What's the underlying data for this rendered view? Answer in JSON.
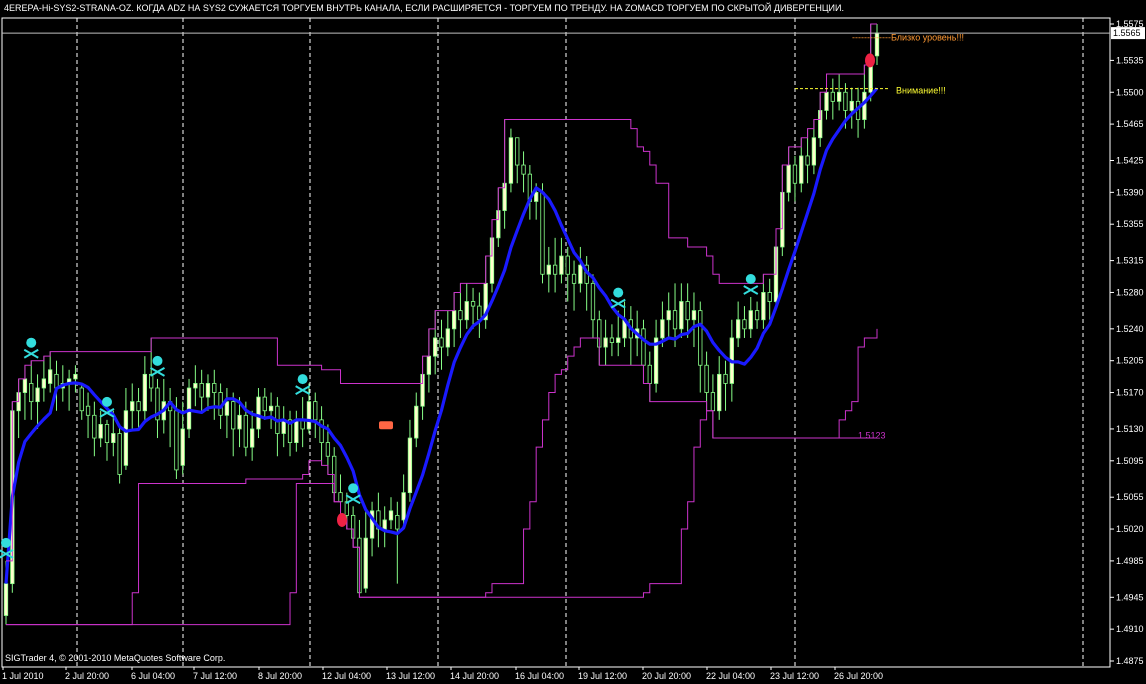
{
  "header": {
    "title": "4EREPA-Hi-SYS2-STRANA-OZ. КОГДА ADZ НА SYS2 СУЖАЕТСЯ ТОРГУЕМ ВНУТРЬ КАНАЛА, ЕСЛИ РАСШИРЯЕТСЯ - ТОРГУЕМ ПО ТРЕНДУ. НА ZOMACD ТОРГУЕМ ПО СКРЫТОЙ ДИВЕРГЕНЦИИ."
  },
  "footer": {
    "copyright": "SIGTrader 4, © 2001-2010 MetaQuotes Software Corp."
  },
  "colors": {
    "background": "#000000",
    "candle_up": "#ffffcc",
    "candle_down": "#000000",
    "wick": "#88ff88",
    "channel": "#cc33cc",
    "moving_average": "#1a1aff",
    "grid": "#ffffff",
    "price_line": "#c0c0c0",
    "skull": "#33dddd",
    "alert_near": "#ff9933",
    "alert_attention": "#ffff33",
    "channel_label": "#cc33cc"
  },
  "chart_data": {
    "type": "candlestick",
    "instrument_info": "4EREPA-Hi-SYS2-STRANA-OZ",
    "x_tick_labels": [
      "1 Jul 2010",
      "2 Jul 20:00",
      "6 Jul 04:00",
      "7 Jul 12:00",
      "8 Jul 20:00",
      "12 Jul 04:00",
      "13 Jul 12:00",
      "14 Jul 20:00",
      "16 Jul 04:00",
      "19 Jul 12:00",
      "20 Jul 20:00",
      "22 Jul 04:00",
      "23 Jul 12:00",
      "26 Jul 20:00"
    ],
    "y_tick_labels": [
      "1.5575",
      "1.5535",
      "1.5500",
      "1.5465",
      "1.5425",
      "1.5390",
      "1.5355",
      "1.5315",
      "1.5280",
      "1.5240",
      "1.5205",
      "1.5170",
      "1.5130",
      "1.5095",
      "1.5055",
      "1.5020",
      "1.4985",
      "1.4945",
      "1.4910",
      "1.4875"
    ],
    "ylim": [
      1.4875,
      1.5575
    ],
    "current_price": "1.5565",
    "channel_value_label": "1.5123",
    "annotations": {
      "near_level": "-------------Близко уровень!!!",
      "attention": "Внимание!!!"
    },
    "candles": [
      [
        1.4925,
        1.496,
        1.4915,
        1.4985
      ],
      [
        1.496,
        1.515,
        1.495,
        1.516
      ],
      [
        1.515,
        1.517,
        1.512,
        1.5185
      ],
      [
        1.517,
        1.5185,
        1.514,
        1.52
      ],
      [
        1.518,
        1.516,
        1.514,
        1.5205
      ],
      [
        1.516,
        1.5175,
        1.513,
        1.519
      ],
      [
        1.5175,
        1.5185,
        1.516,
        1.521
      ],
      [
        1.518,
        1.5195,
        1.517,
        1.5215
      ],
      [
        1.519,
        1.5175,
        1.515,
        1.5205
      ],
      [
        1.5175,
        1.518,
        1.516,
        1.52
      ],
      [
        1.518,
        1.5185,
        1.515,
        1.5195
      ],
      [
        1.5185,
        1.519,
        1.517,
        1.52
      ],
      [
        1.5175,
        1.515,
        1.514,
        1.518
      ],
      [
        1.5155,
        1.5145,
        1.512,
        1.517
      ],
      [
        1.5145,
        1.512,
        1.51,
        1.516
      ],
      [
        1.512,
        1.5135,
        1.511,
        1.515
      ],
      [
        1.5135,
        1.5115,
        1.5095,
        1.514
      ],
      [
        1.5115,
        1.5125,
        1.51,
        1.515
      ],
      [
        1.5125,
        1.508,
        1.507,
        1.5135
      ],
      [
        1.509,
        1.515,
        1.5085,
        1.5175
      ],
      [
        1.515,
        1.516,
        1.513,
        1.518
      ],
      [
        1.516,
        1.515,
        1.513,
        1.5175
      ],
      [
        1.515,
        1.519,
        1.514,
        1.521
      ],
      [
        1.519,
        1.5175,
        1.516,
        1.523
      ],
      [
        1.5175,
        1.514,
        1.512,
        1.5185
      ],
      [
        1.514,
        1.516,
        1.5125,
        1.5185
      ],
      [
        1.516,
        1.515,
        1.511,
        1.5175
      ],
      [
        1.515,
        1.5085,
        1.5075,
        1.5165
      ],
      [
        1.509,
        1.513,
        1.508,
        1.516
      ],
      [
        1.513,
        1.5175,
        1.512,
        1.5185
      ],
      [
        1.5175,
        1.518,
        1.5155,
        1.52
      ],
      [
        1.518,
        1.5165,
        1.515,
        1.5195
      ],
      [
        1.5165,
        1.518,
        1.515,
        1.519
      ],
      [
        1.518,
        1.517,
        1.514,
        1.5195
      ],
      [
        1.517,
        1.5145,
        1.513,
        1.518
      ],
      [
        1.5145,
        1.516,
        1.512,
        1.5175
      ],
      [
        1.516,
        1.513,
        1.51,
        1.517
      ],
      [
        1.513,
        1.5145,
        1.511,
        1.5165
      ],
      [
        1.5145,
        1.511,
        1.51,
        1.516
      ],
      [
        1.511,
        1.513,
        1.5095,
        1.515
      ],
      [
        1.513,
        1.5165,
        1.512,
        1.5175
      ],
      [
        1.5165,
        1.515,
        1.514,
        1.5175
      ],
      [
        1.515,
        1.5155,
        1.513,
        1.517
      ],
      [
        1.5155,
        1.5125,
        1.51,
        1.5165
      ],
      [
        1.5125,
        1.514,
        1.511,
        1.5155
      ],
      [
        1.514,
        1.5115,
        1.51,
        1.515
      ],
      [
        1.5115,
        1.514,
        1.5105,
        1.515
      ],
      [
        1.514,
        1.513,
        1.511,
        1.5165
      ],
      [
        1.513,
        1.516,
        1.5125,
        1.518
      ],
      [
        1.516,
        1.514,
        1.512,
        1.517
      ],
      [
        1.514,
        1.5115,
        1.509,
        1.5155
      ],
      [
        1.5115,
        1.51,
        1.508,
        1.5135
      ],
      [
        1.51,
        1.506,
        1.505,
        1.511
      ],
      [
        1.506,
        1.505,
        1.503,
        1.508
      ],
      [
        1.505,
        1.5035,
        1.502,
        1.506
      ],
      [
        1.5035,
        1.501,
        1.5,
        1.5045
      ],
      [
        1.501,
        1.495,
        1.4945,
        1.503
      ],
      [
        1.4955,
        1.501,
        1.495,
        1.504
      ],
      [
        1.501,
        1.504,
        1.499,
        1.505
      ],
      [
        1.504,
        1.502,
        1.5,
        1.506
      ],
      [
        1.502,
        1.503,
        1.5,
        1.5045
      ],
      [
        1.503,
        1.504,
        1.502,
        1.5055
      ],
      [
        1.5035,
        1.502,
        1.496,
        1.505
      ],
      [
        1.503,
        1.506,
        1.502,
        1.508
      ],
      [
        1.506,
        1.512,
        1.505,
        1.514
      ],
      [
        1.512,
        1.5155,
        1.511,
        1.517
      ],
      [
        1.5155,
        1.519,
        1.514,
        1.521
      ],
      [
        1.519,
        1.521,
        1.517,
        1.524
      ],
      [
        1.521,
        1.523,
        1.519,
        1.526
      ],
      [
        1.523,
        1.522,
        1.5195,
        1.525
      ],
      [
        1.522,
        1.524,
        1.521,
        1.526
      ],
      [
        1.524,
        1.526,
        1.522,
        1.528
      ],
      [
        1.526,
        1.525,
        1.523,
        1.529
      ],
      [
        1.525,
        1.527,
        1.524,
        1.529
      ],
      [
        1.527,
        1.5265,
        1.524,
        1.5285
      ],
      [
        1.5265,
        1.525,
        1.523,
        1.528
      ],
      [
        1.525,
        1.529,
        1.524,
        1.532
      ],
      [
        1.529,
        1.534,
        1.528,
        1.536
      ],
      [
        1.534,
        1.537,
        1.533,
        1.5395
      ],
      [
        1.537,
        1.54,
        1.535,
        1.547
      ],
      [
        1.54,
        1.545,
        1.539,
        1.546
      ],
      [
        1.545,
        1.542,
        1.54,
        1.544
      ],
      [
        1.542,
        1.541,
        1.539,
        1.5435
      ],
      [
        1.541,
        1.538,
        1.536,
        1.542
      ],
      [
        1.538,
        1.539,
        1.536,
        1.54
      ],
      [
        1.539,
        1.53,
        1.529,
        1.54
      ],
      [
        1.53,
        1.531,
        1.528,
        1.533
      ],
      [
        1.531,
        1.53,
        1.528,
        1.534
      ],
      [
        1.53,
        1.532,
        1.529,
        1.534
      ],
      [
        1.532,
        1.53,
        1.527,
        1.533
      ],
      [
        1.53,
        1.529,
        1.526,
        1.5315
      ],
      [
        1.529,
        1.531,
        1.528,
        1.533
      ],
      [
        1.531,
        1.529,
        1.526,
        1.532
      ],
      [
        1.529,
        1.525,
        1.523,
        1.53
      ],
      [
        1.525,
        1.522,
        1.52,
        1.526
      ],
      [
        1.522,
        1.523,
        1.52,
        1.525
      ],
      [
        1.523,
        1.5225,
        1.521,
        1.5245
      ],
      [
        1.5225,
        1.523,
        1.521,
        1.526
      ],
      [
        1.523,
        1.525,
        1.522,
        1.527
      ],
      [
        1.525,
        1.523,
        1.52,
        1.5265
      ],
      [
        1.523,
        1.524,
        1.521,
        1.526
      ],
      [
        1.524,
        1.52,
        1.518,
        1.525
      ],
      [
        1.52,
        1.518,
        1.516,
        1.5215
      ],
      [
        1.518,
        1.523,
        1.517,
        1.525
      ],
      [
        1.523,
        1.525,
        1.522,
        1.527
      ],
      [
        1.525,
        1.526,
        1.523,
        1.528
      ],
      [
        1.526,
        1.524,
        1.522,
        1.529
      ],
      [
        1.524,
        1.527,
        1.523,
        1.529
      ],
      [
        1.527,
        1.525,
        1.523,
        1.529
      ],
      [
        1.525,
        1.526,
        1.522,
        1.528
      ],
      [
        1.526,
        1.52,
        1.517,
        1.527
      ],
      [
        1.52,
        1.517,
        1.515,
        1.5215
      ],
      [
        1.517,
        1.515,
        1.512,
        1.519
      ],
      [
        1.515,
        1.519,
        1.514,
        1.521
      ],
      [
        1.519,
        1.518,
        1.515,
        1.5205
      ],
      [
        1.518,
        1.523,
        1.516,
        1.525
      ],
      [
        1.523,
        1.525,
        1.522,
        1.527
      ],
      [
        1.525,
        1.524,
        1.523,
        1.5265
      ],
      [
        1.524,
        1.526,
        1.523,
        1.5275
      ],
      [
        1.526,
        1.525,
        1.524,
        1.527
      ],
      [
        1.525,
        1.528,
        1.524,
        1.53
      ],
      [
        1.528,
        1.527,
        1.525,
        1.5295
      ],
      [
        1.527,
        1.533,
        1.526,
        1.535
      ],
      [
        1.533,
        1.539,
        1.532,
        1.542
      ],
      [
        1.539,
        1.542,
        1.538,
        1.544
      ],
      [
        1.542,
        1.54,
        1.538,
        1.543
      ],
      [
        1.54,
        1.543,
        1.539,
        1.545
      ],
      [
        1.543,
        1.542,
        1.54,
        1.546
      ],
      [
        1.542,
        1.545,
        1.541,
        1.547
      ],
      [
        1.545,
        1.548,
        1.544,
        1.55
      ],
      [
        1.548,
        1.55,
        1.547,
        1.552
      ],
      [
        1.55,
        1.549,
        1.547,
        1.5515
      ],
      [
        1.549,
        1.55,
        1.548,
        1.552
      ],
      [
        1.55,
        1.548,
        1.546,
        1.551
      ],
      [
        1.548,
        1.549,
        1.546,
        1.5505
      ],
      [
        1.549,
        1.547,
        1.545,
        1.5505
      ],
      [
        1.547,
        1.55,
        1.546,
        1.553
      ],
      [
        1.55,
        1.554,
        1.549,
        1.5575
      ],
      [
        1.554,
        1.5565,
        1.553,
        1.5575
      ]
    ]
  }
}
